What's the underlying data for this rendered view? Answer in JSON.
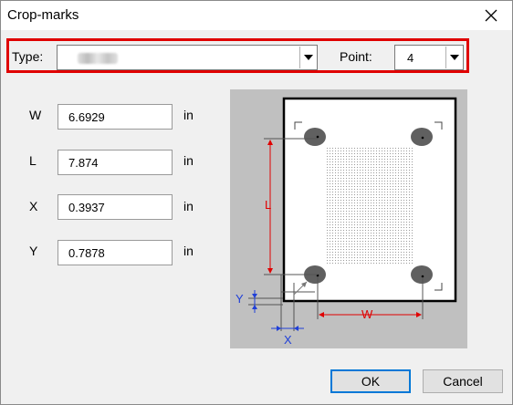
{
  "window": {
    "title": "Crop-marks"
  },
  "type_field": {
    "label": "Type:",
    "value": ""
  },
  "point_field": {
    "label": "Point:",
    "value": "4"
  },
  "fields": [
    {
      "label": "W",
      "value": "6.6929",
      "unit": "in"
    },
    {
      "label": "L",
      "value": "7.874",
      "unit": "in"
    },
    {
      "label": "X",
      "value": "0.3937",
      "unit": "in"
    },
    {
      "label": "Y",
      "value": "0.7878",
      "unit": "in"
    }
  ],
  "diagram": {
    "w_label": "W",
    "l_label": "L",
    "x_label": "X",
    "y_label": "Y"
  },
  "buttons": {
    "ok": "OK",
    "cancel": "Cancel"
  },
  "colors": {
    "highlight": "#e00000",
    "dimension_red": "#e00000",
    "dimension_blue": "#1f3fd8",
    "ok_focus": "#0078d7"
  },
  "icons": [
    "close-icon",
    "chevron-down-icon"
  ]
}
